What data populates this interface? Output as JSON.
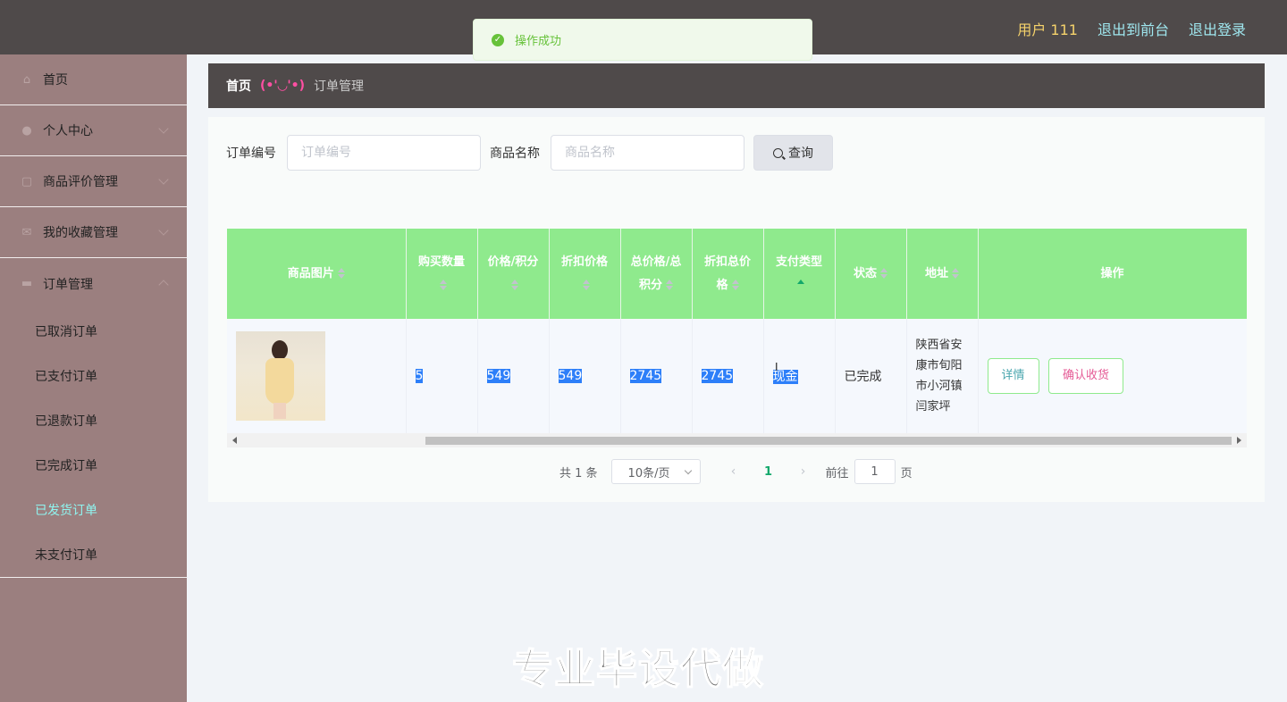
{
  "header": {
    "user_label": "用户 111",
    "back_front": "退出到前台",
    "logout": "退出登录"
  },
  "toast": {
    "message": "操作成功",
    "color": "#67c23a"
  },
  "sidebar": {
    "items": [
      {
        "label": "首页",
        "icon": "home-icon"
      },
      {
        "label": "个人中心",
        "icon": "user-icon"
      },
      {
        "label": "商品评价管理",
        "icon": "comment-icon"
      },
      {
        "label": "我的收藏管理",
        "icon": "mail-icon"
      },
      {
        "label": "订单管理",
        "icon": "bag-icon"
      }
    ],
    "sub_items": [
      "已取消订单",
      "已支付订单",
      "已退款订单",
      "已完成订单",
      "已发货订单",
      "未支付订单"
    ],
    "active_sub": "已发货订单"
  },
  "breadcrumb": {
    "home": "首页",
    "separator": "(•'◡'•)",
    "current": "订单管理"
  },
  "search": {
    "order_no_label": "订单编号",
    "order_no_placeholder": "订单编号",
    "goods_label": "商品名称",
    "goods_placeholder": "商品名称",
    "query_button": "查询"
  },
  "table": {
    "columns": [
      "商品图片",
      "购买数量",
      "价格/积分",
      "折扣价格",
      "总价格/总积分",
      "折扣总价格",
      "支付类型",
      "状态",
      "地址",
      "操作"
    ],
    "rows": [
      {
        "quantity": "5",
        "price": "549",
        "discount_price": "549",
        "total": "2745",
        "discount_total": "2745",
        "pay_type": "现金",
        "status": "已完成",
        "address": "陕西省安康市旬阳市小河镇闫家坪",
        "actions": {
          "detail": "详情",
          "confirm": "确认收货"
        }
      }
    ]
  },
  "pagination": {
    "total": "共 1 条",
    "page_size": "10条/页",
    "current_page": "1",
    "goto_label": "前往",
    "goto_value": "1",
    "page_suffix": "页"
  },
  "watermark": "专业毕设代做",
  "colors": {
    "header_bg": "#4f4a4a",
    "sidebar_bg": "#9b7f7f",
    "table_header_bg": "#8fea8d",
    "active_sub": "#8ff5f0",
    "selection": "#2d7ff9"
  }
}
